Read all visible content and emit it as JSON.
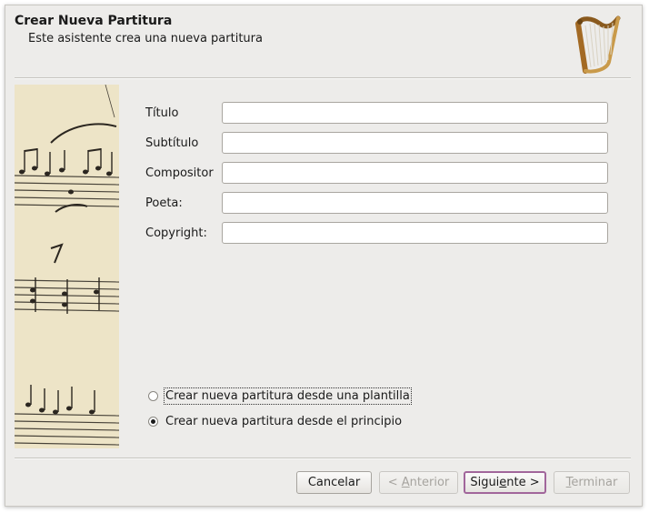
{
  "header": {
    "title": "Crear Nueva Partitura",
    "subtitle": "Este asistente crea una nueva partitura",
    "logo_icon": "harp-icon"
  },
  "form": {
    "fields": [
      {
        "label": "Título",
        "value": ""
      },
      {
        "label": "Subtítulo",
        "value": ""
      },
      {
        "label": "Compositor",
        "value": ""
      },
      {
        "label": "Poeta:",
        "value": ""
      },
      {
        "label": "Copyright:",
        "value": ""
      }
    ]
  },
  "options": [
    {
      "label": "Crear nueva partitura desde una plantilla",
      "selected": false
    },
    {
      "label": "Crear nueva partitura desde el principio",
      "selected": true
    }
  ],
  "buttons": {
    "cancel": "Cancelar",
    "back_pre": "< ",
    "back_mn": "A",
    "back_post": "nterior",
    "next_pre": "Sigui",
    "next_mn": "e",
    "next_post": "nte >",
    "finish_mn": "T",
    "finish_post": "erminar"
  },
  "colors": {
    "dialog_bg": "#edecea",
    "default_button_border": "#a1669b",
    "sheet_music_bg": "#ede4c7"
  }
}
